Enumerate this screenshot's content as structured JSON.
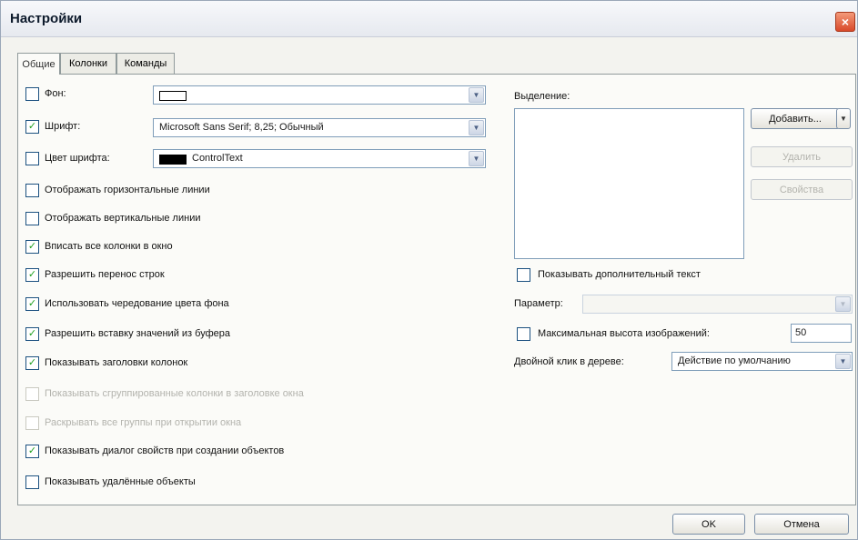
{
  "window": {
    "title": "Настройки",
    "close_glyph": "×"
  },
  "tabs": [
    {
      "label": "Общие",
      "active": true
    },
    {
      "label": "Колонки",
      "active": false
    },
    {
      "label": "Команды",
      "active": false
    }
  ],
  "general": {
    "background": {
      "label": "Фон:",
      "checked": false
    },
    "font": {
      "label": "Шрифт:",
      "checked": true,
      "value": "Microsoft Sans Serif; 8,25; Обычный"
    },
    "font_color": {
      "label": "Цвет шрифта:",
      "checked": false,
      "value": "ControlText"
    },
    "options": [
      {
        "label": "Отображать горизонтальные линии",
        "checked": false,
        "enabled": true
      },
      {
        "label": "Отображать вертикальные линии",
        "checked": false,
        "enabled": true
      },
      {
        "label": "Вписать все колонки в окно",
        "checked": true,
        "enabled": true
      },
      {
        "label": "Разрешить перенос строк",
        "checked": true,
        "enabled": true
      },
      {
        "label": "Использовать чередование цвета фона",
        "checked": true,
        "enabled": true
      },
      {
        "label": "Разрешить вставку значений из буфера",
        "checked": true,
        "enabled": true
      },
      {
        "label": "Показывать заголовки колонок",
        "checked": true,
        "enabled": true
      },
      {
        "label": "Показывать сгруппированные колонки в заголовке окна",
        "checked": false,
        "enabled": false
      },
      {
        "label": "Раскрывать все группы при открытии окна",
        "checked": false,
        "enabled": false
      },
      {
        "label": "Показывать диалог свойств при создании объектов",
        "checked": true,
        "enabled": true
      },
      {
        "label": "Показывать удалённые объекты",
        "checked": false,
        "enabled": true
      }
    ]
  },
  "selection": {
    "label": "Выделение:",
    "add_button": "Добавить...",
    "delete_button": "Удалить",
    "properties_button": "Свойства",
    "show_extra_text": {
      "label": "Показывать дополнительный текст",
      "checked": false
    },
    "parameter": {
      "label": "Параметр:",
      "value": ""
    },
    "max_image_height": {
      "label": "Максимальная высота изображений:",
      "checked": false,
      "value": "50"
    },
    "double_click": {
      "label": "Двойной клик в дереве:",
      "value": "Действие по умолчанию"
    }
  },
  "footer": {
    "ok": "OK",
    "cancel": "Отмена"
  },
  "icons": {
    "dropdown": "▼",
    "check": "✓"
  }
}
